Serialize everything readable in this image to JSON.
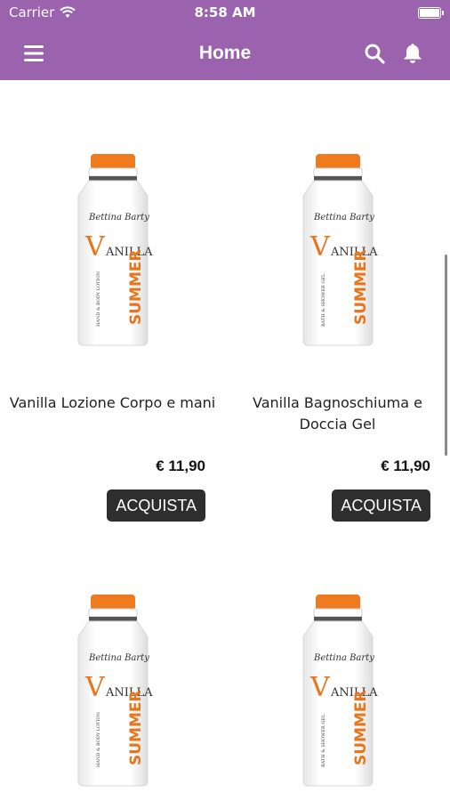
{
  "status_bar": {
    "carrier": "Carrier",
    "time": "8:58 AM"
  },
  "navbar": {
    "title": "Home",
    "menu_icon": "menu-icon",
    "search_icon": "search-icon",
    "bell_icon": "bell-icon"
  },
  "colors": {
    "brand": "#9b62ad",
    "button": "#2e2e2e",
    "bottle_cap": "#f07b1e"
  },
  "products": [
    {
      "name": "Vanilla Lozione Corpo e mani",
      "price": "€ 11,90",
      "button": "ACQUISTA",
      "label": {
        "brand": "Bettina Barty",
        "title": "VANILLA",
        "line": "SUMMER",
        "sub": "HAND & BODY LOTION"
      }
    },
    {
      "name": "Vanilla Bagnoschiuma e Doccia Gel",
      "price": "€ 11,90",
      "button": "ACQUISTA",
      "label": {
        "brand": "Bettina Barty",
        "title": "VANILLA",
        "line": "SUMMER",
        "sub": "BATH & SHOWER GEL"
      }
    },
    {
      "label": {
        "brand": "Bettina Barty",
        "title": "VANILLA",
        "line": "SUMMER",
        "sub": "HAND & BODY LOTION"
      }
    },
    {
      "label": {
        "brand": "Bettina Barty",
        "title": "VANILLA",
        "line": "SUMMER",
        "sub": "BATH & SHOWER GEL"
      }
    }
  ]
}
